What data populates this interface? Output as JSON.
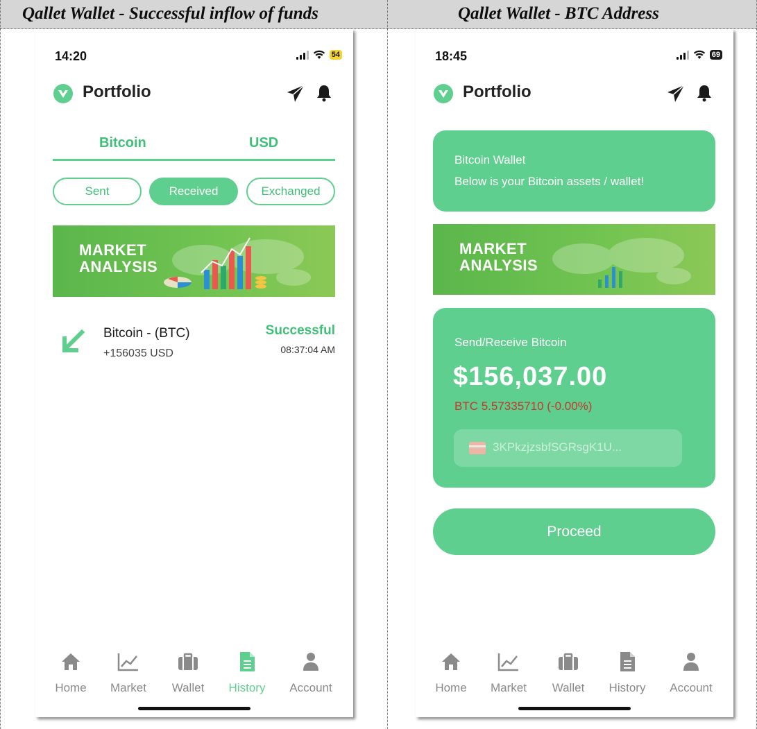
{
  "captions": {
    "left": "Qallet Wallet - Successful inflow of funds",
    "right": "Qallet Wallet - BTC Address"
  },
  "colors": {
    "accent": "#5ecf8e",
    "accent_text": "#3fbf77",
    "negative": "#c8352c"
  },
  "left_screen": {
    "status": {
      "time": "14:20",
      "battery": "54"
    },
    "header": {
      "title": "Portfolio"
    },
    "tabs": [
      {
        "label": "Bitcoin"
      },
      {
        "label": "USD"
      }
    ],
    "filters": [
      {
        "label": "Sent"
      },
      {
        "label": "Received",
        "selected": true
      },
      {
        "label": "Exchanged"
      }
    ],
    "banner": {
      "line1": "MARKET",
      "line2": "ANALYSIS"
    },
    "transactions": [
      {
        "name": "Bitcoin - (BTC)",
        "amount": "+156035 USD",
        "status": "Successful",
        "time": "08:37:04 AM",
        "icon": "arrow-down-left-icon"
      }
    ],
    "nav": [
      {
        "label": "Home",
        "icon": "home-icon"
      },
      {
        "label": "Market",
        "icon": "chart-icon"
      },
      {
        "label": "Wallet",
        "icon": "wallet-icon"
      },
      {
        "label": "History",
        "icon": "history-icon",
        "active": true
      },
      {
        "label": "Account",
        "icon": "account-icon"
      }
    ]
  },
  "right_screen": {
    "status": {
      "time": "18:45",
      "battery": "69"
    },
    "header": {
      "title": "Portfolio"
    },
    "info_card": {
      "title": "Bitcoin Wallet",
      "subtitle": "Below is your Bitcoin assets / wallet!"
    },
    "banner": {
      "line1": "MARKET",
      "line2": "ANALYSIS"
    },
    "balance_card": {
      "label": "Send/Receive Bitcoin",
      "amount": "$156,037.00",
      "btc": "BTC 5.57335710 (-0.00%)",
      "address": "3KPkzjzsbfSGRsgK1U..."
    },
    "proceed": {
      "label": "Proceed"
    },
    "nav": [
      {
        "label": "Home",
        "icon": "home-icon"
      },
      {
        "label": "Market",
        "icon": "chart-icon"
      },
      {
        "label": "Wallet",
        "icon": "wallet-icon"
      },
      {
        "label": "History",
        "icon": "history-icon"
      },
      {
        "label": "Account",
        "icon": "account-icon"
      }
    ]
  }
}
